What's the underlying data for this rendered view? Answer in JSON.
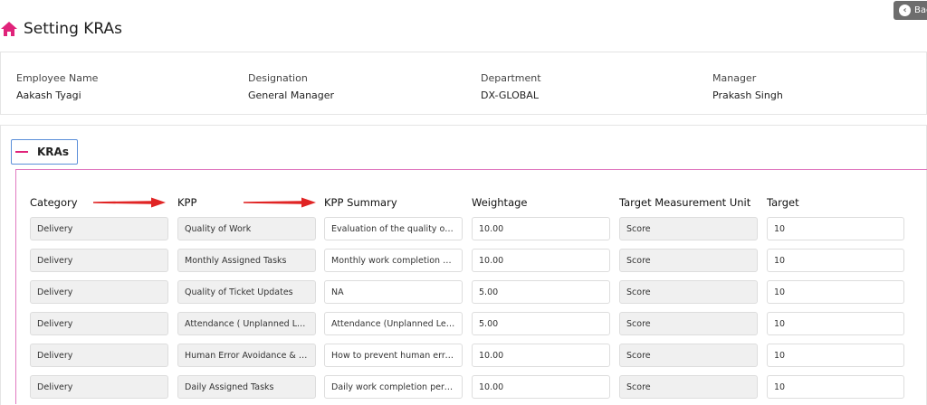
{
  "header": {
    "title": "Setting KRAs",
    "back_label": "Back",
    "icons": {
      "home": "home-icon",
      "back": "chevron-left-circle-icon"
    }
  },
  "employee": {
    "fields": [
      {
        "label": "Employee Name",
        "value": "Aakash Tyagi"
      },
      {
        "label": "Designation",
        "value": "General Manager"
      },
      {
        "label": "Department",
        "value": "DX-GLOBAL"
      },
      {
        "label": "Manager",
        "value": "Prakash Singh"
      }
    ]
  },
  "kras": {
    "section_label": "KRAs",
    "columns": [
      "Category",
      "KPP",
      "KPP Summary",
      "Weightage",
      "Target Measurement Unit",
      "Target"
    ],
    "rows": [
      {
        "category": "Delivery",
        "kpp": "Quality of Work",
        "summary": "Evaluation of the quality of work",
        "weightage": "10.00",
        "unit": "Score",
        "target": "10"
      },
      {
        "category": "Delivery",
        "kpp": "Monthly Assigned Tasks",
        "summary": "Monthly work completion percentage",
        "weightage": "10.00",
        "unit": "Score",
        "target": "10"
      },
      {
        "category": "Delivery",
        "kpp": "Quality of Ticket Updates",
        "summary": "NA",
        "weightage": "5.00",
        "unit": "Score",
        "target": "10"
      },
      {
        "category": "Delivery",
        "kpp": "Attendance ( Unplanned Leaves)",
        "summary": "Attendance (Unplanned Leaves)",
        "weightage": "5.00",
        "unit": "Score",
        "target": "10"
      },
      {
        "category": "Delivery",
        "kpp": "Human Error Avoidance & Compliance",
        "summary": "How to prevent human errors in work",
        "weightage": "10.00",
        "unit": "Score",
        "target": "10"
      },
      {
        "category": "Delivery",
        "kpp": "Daily Assigned Tasks",
        "summary": "Daily work completion percentage",
        "weightage": "10.00",
        "unit": "Score",
        "target": "10"
      }
    ]
  },
  "colors": {
    "accent": "#e0237a",
    "panel_border": "#e07ac0",
    "toggle_border": "#5b8fd9",
    "arrow": "#e02424",
    "readonly_bg": "#f0f0f0"
  }
}
